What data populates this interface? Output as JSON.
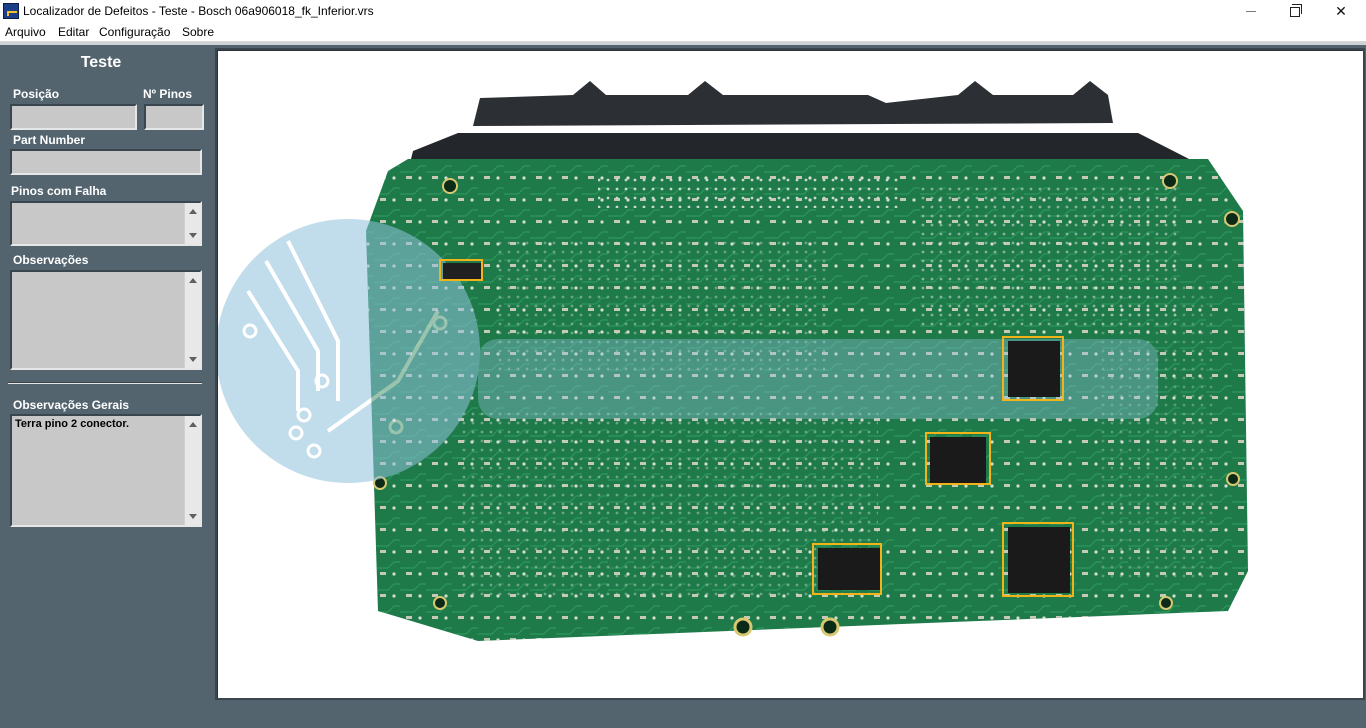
{
  "window": {
    "title": "Localizador de Defeitos - Teste - Bosch 06a906018_fk_Inferior.vrs"
  },
  "menu": {
    "items": [
      "Arquivo",
      "Editar",
      "Configuração",
      "Sobre"
    ]
  },
  "sidebar": {
    "title": "Teste",
    "position_label": "Posição",
    "position_value": "",
    "pins_label": "Nº Pinos",
    "pins_value": "",
    "part_number_label": "Part Number",
    "part_number_value": "",
    "failing_pins_label": "Pinos com Falha",
    "failing_pins_value": "",
    "observations_label": "Observações",
    "observations_value": "",
    "general_observations_label": "Observações Gerais",
    "general_observations_value": "Terra pino 2 conector."
  },
  "board_image": {
    "watermark_icon": "circuit-logo-icon",
    "highlight_color": "#f2b418",
    "board_color": "#1f7a4a"
  }
}
